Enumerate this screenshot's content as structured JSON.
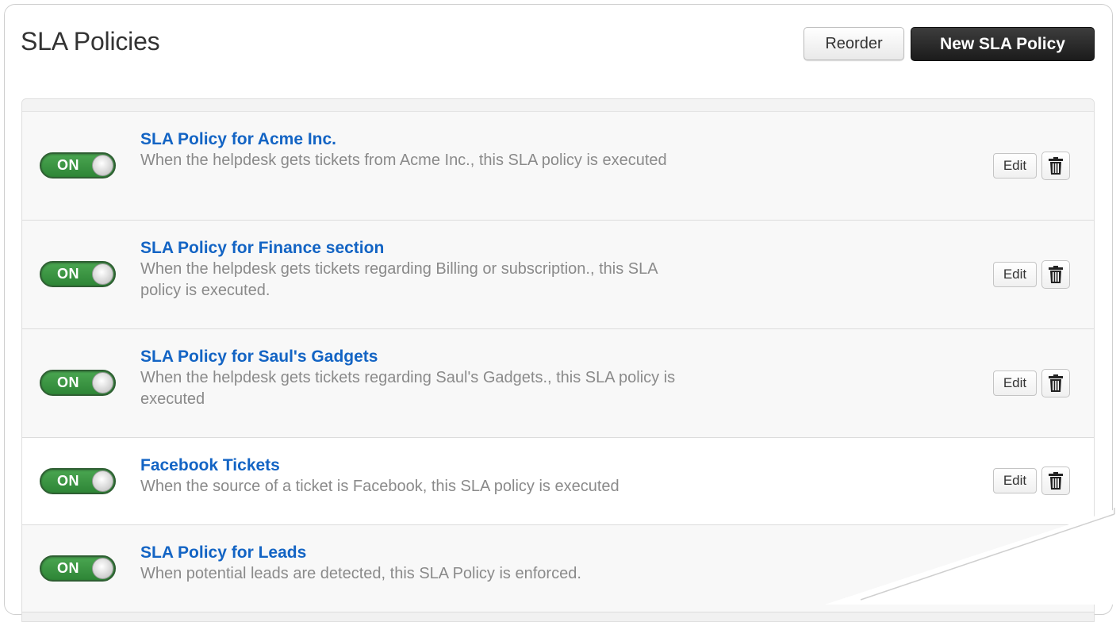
{
  "header": {
    "title": "SLA Policies",
    "reorder_label": "Reorder",
    "new_label": "New SLA Policy"
  },
  "policies": [
    {
      "title": "SLA Policy for Acme Inc.",
      "description": "When the helpdesk gets tickets from Acme Inc., this SLA policy is executed",
      "toggle": "ON",
      "edit_label": "Edit",
      "delete_icon": "trash-icon"
    },
    {
      "title": "SLA Policy for Finance section",
      "description": "When the helpdesk gets tickets regarding Billing or subscription., this SLA policy is executed.",
      "toggle": "ON",
      "edit_label": "Edit",
      "delete_icon": "trash-icon"
    },
    {
      "title": "SLA Policy for Saul's Gadgets",
      "description": "When the helpdesk gets tickets regarding Saul's Gadgets., this SLA policy is executed",
      "toggle": "ON",
      "edit_label": "Edit",
      "delete_icon": "trash-icon"
    },
    {
      "title": "Facebook Tickets",
      "description": "When the source of a ticket is Facebook, this SLA policy is executed",
      "toggle": "ON",
      "edit_label": "Edit",
      "delete_icon": "trash-icon"
    },
    {
      "title": "SLA Policy for Leads",
      "description": "When potential leads are detected, this SLA Policy is enforced.",
      "toggle": "ON"
    }
  ],
  "colors": {
    "link": "#1364c4",
    "toggle_on": "#3a9a43",
    "primary_button": "#222222"
  }
}
